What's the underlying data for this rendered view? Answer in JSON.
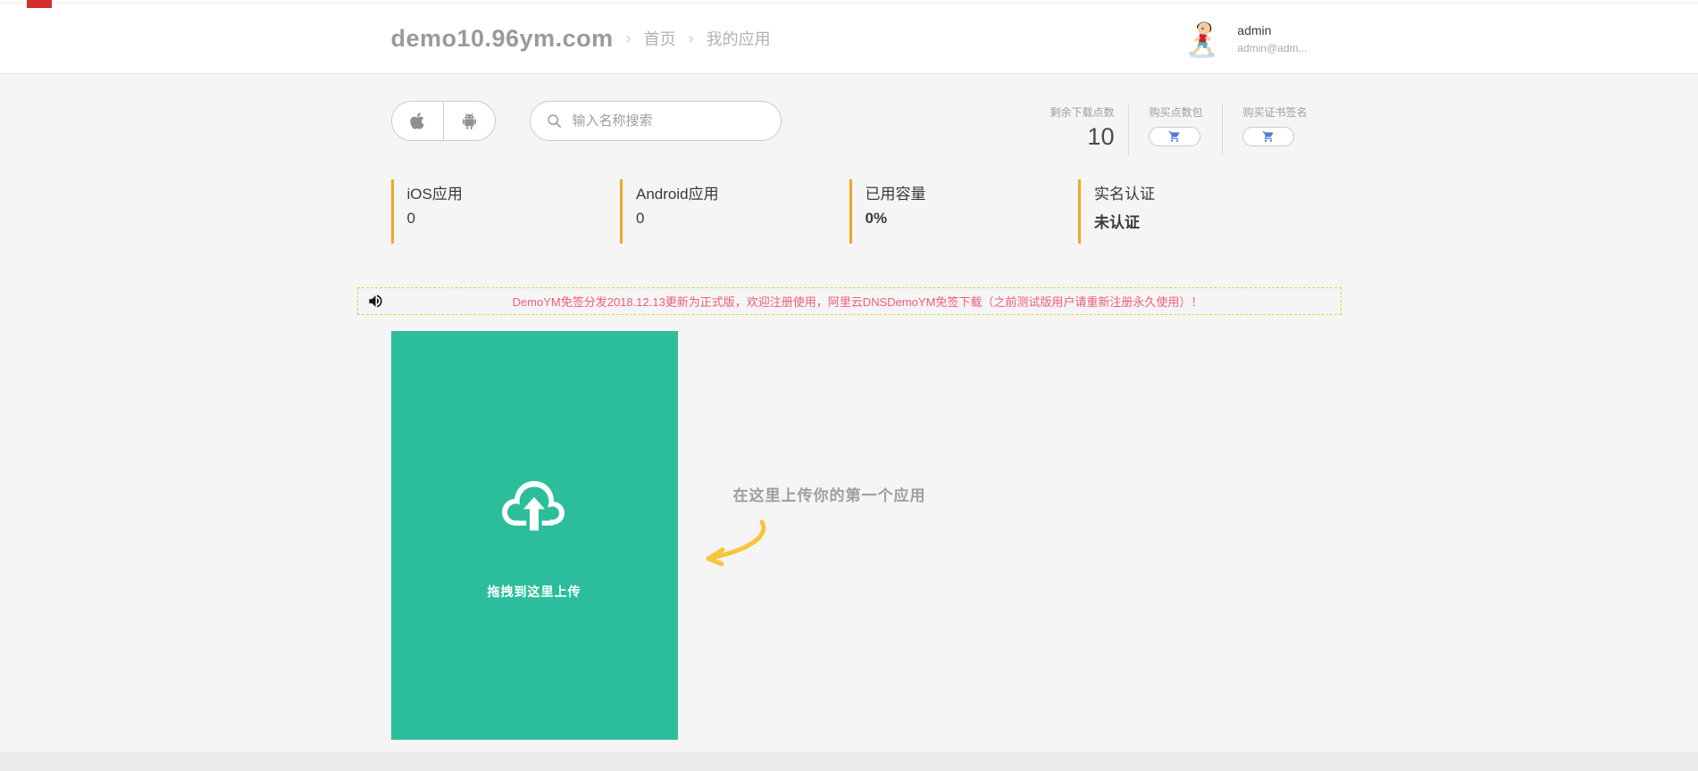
{
  "header": {
    "site_title": "demo10.96ym.com",
    "separator": "›",
    "breadcrumbs": {
      "home": "首页",
      "current": "我的应用"
    },
    "user": {
      "name": "admin",
      "email_truncated": "admin@adm..."
    }
  },
  "toolbar": {
    "search": {
      "placeholder": "输入名称搜索"
    },
    "remaining_points": {
      "label": "剩余下载点数",
      "value": "10"
    },
    "buy_points": {
      "label": "购买点数包"
    },
    "buy_certificate": {
      "label": "购买证书签名"
    }
  },
  "stats": [
    {
      "label": "iOS应用",
      "value": "0"
    },
    {
      "label": "Android应用",
      "value": "0"
    },
    {
      "label": "已用容量",
      "value": "0%"
    },
    {
      "label": "实名认证",
      "value": "未认证"
    }
  ],
  "notice": {
    "text": "DemoYM免签分发2018.12.13更新为正式版，欢迎注册使用，阿里云DNSDemoYM免签下载（之前测试版用户请重新注册永久使用）！"
  },
  "upload": {
    "dropzone_label": "拖拽到这里上传",
    "hint": "在这里上传你的第一个应用"
  },
  "colors": {
    "teal": "#2cbe9c",
    "stat_accent": "#f0a71e",
    "notice_border": "#cddc39",
    "notice_text": "#f25c78",
    "arrow_yellow": "#f6c53e",
    "cart_blue": "#4a7bd9",
    "header_bg": "#ffffff",
    "page_bg": "#f5f5f6",
    "footer_bg": "#ebebeb"
  }
}
